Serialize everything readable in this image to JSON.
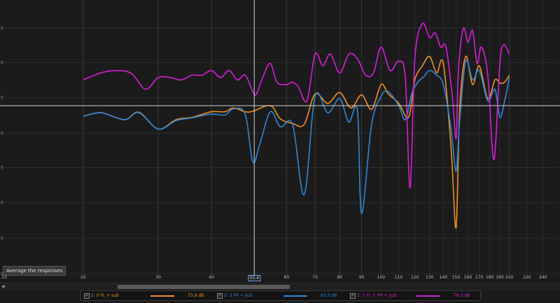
{
  "tooltip": "Average the responses",
  "cursor_x_label": "50,4",
  "colors": {
    "orange": "#f0901e",
    "blue": "#2f86d6",
    "magenta": "#d81ed8",
    "grid": "#2c2c2c",
    "crosshair": "#d0d0d0"
  },
  "legend": [
    {
      "name": "1: 0 FL + sub",
      "value": "73,9 dB",
      "color": "#f0901e"
    },
    {
      "name": "2: 2 FR + sub",
      "value": "63,3 dB",
      "color": "#2f86d6"
    },
    {
      "name": "3: 1 FL + FR + sub",
      "value": "78,3 dB",
      "color": "#d81ed8"
    }
  ],
  "x_tick_labels": [
    "13",
    "20",
    "30",
    "40",
    "50,4",
    "60",
    "70",
    "80",
    "90",
    "100",
    "110",
    "120",
    "130",
    "140",
    "150",
    "160",
    "170",
    "180",
    "190",
    "200",
    "220",
    "240"
  ],
  "chart_data": {
    "type": "line",
    "xscale": "log",
    "xlim": [
      13,
      260
    ],
    "crosshair_x": 50.4,
    "y_tick_labels": [
      "5",
      "0",
      "5",
      "0",
      "5",
      "0",
      "5",
      "0",
      "5"
    ],
    "series": [
      {
        "name": "1: 0 FL + sub",
        "x": [
          20,
          22,
          25,
          27,
          30,
          33,
          36,
          40,
          43,
          45,
          48,
          50,
          55,
          58,
          62,
          66,
          70,
          75,
          80,
          85,
          90,
          95,
          100,
          104,
          110,
          116,
          120,
          125,
          130,
          135,
          140,
          146,
          150,
          153,
          158,
          164,
          170,
          178,
          185,
          190,
          195,
          200
        ],
        "y": [
          -2.3,
          -1.5,
          -3.0,
          -1.4,
          -5.0,
          -3.0,
          -2.5,
          -1.3,
          -1.3,
          -0.5,
          -1.3,
          -1.2,
          0.0,
          -2.8,
          -3.8,
          -4.0,
          2.5,
          0.5,
          2.8,
          -0.5,
          2.3,
          -0.8,
          4.5,
          2.5,
          0.5,
          -2.5,
          5.5,
          8.5,
          10.5,
          7.0,
          9.0,
          -9.0,
          -26.0,
          -0.5,
          10.5,
          4.5,
          8.5,
          1.5,
          5.5,
          4.8,
          5.0,
          6.5
        ]
      },
      {
        "name": "2: 2 FR + sub",
        "x": [
          20,
          22,
          25,
          27,
          30,
          33,
          36,
          40,
          43,
          45,
          48,
          50,
          52,
          55,
          58,
          62,
          66,
          70,
          75,
          80,
          84,
          88,
          90,
          95,
          100,
          104,
          110,
          114,
          118,
          122,
          126,
          130,
          135,
          140,
          146,
          150,
          153,
          158,
          164,
          170,
          178,
          185,
          190,
          195,
          200
        ],
        "y": [
          -2.3,
          -1.5,
          -3.0,
          -1.5,
          -5.0,
          -3.2,
          -2.6,
          -1.8,
          -2.0,
          -0.7,
          -1.8,
          -12.0,
          -8.0,
          -1.3,
          -4.5,
          -4.0,
          -19.0,
          2.0,
          -1.5,
          1.5,
          -3.5,
          -1.0,
          -23.0,
          -4.0,
          2.0,
          3.0,
          0.0,
          -3.0,
          2.5,
          5.0,
          6.2,
          7.5,
          6.5,
          4.5,
          -5.0,
          -14.0,
          -3.0,
          9.5,
          5.5,
          7.5,
          1.0,
          3.5,
          -2.5,
          1.0,
          6.0
        ]
      },
      {
        "name": "3: 1 FL + FR + sub",
        "x": [
          20,
          22,
          24,
          26,
          28,
          30,
          32,
          34,
          36,
          38,
          40,
          42,
          44,
          46,
          48,
          50,
          51,
          53,
          55,
          57,
          60,
          62,
          64,
          67,
          70,
          73,
          76,
          80,
          84,
          88,
          92,
          96,
          100,
          105,
          110,
          114,
          117,
          120,
          125,
          130,
          134,
          138,
          142,
          147,
          150,
          152,
          156,
          160,
          164,
          168,
          172,
          178,
          184,
          190,
          194,
          200
        ],
        "y": [
          5.5,
          7.0,
          7.5,
          6.8,
          3.5,
          6.0,
          6.0,
          5.5,
          6.5,
          6.5,
          7.5,
          6.0,
          7.5,
          5.5,
          6.5,
          3.0,
          2.5,
          6.5,
          9.0,
          5.0,
          4.5,
          5.0,
          4.0,
          1.0,
          11.0,
          8.5,
          11.0,
          7.0,
          11.0,
          10.0,
          6.5,
          7.0,
          12.5,
          7.5,
          9.5,
          6.0,
          -17.5,
          10.0,
          17.5,
          14.5,
          15.5,
          12.5,
          12.5,
          2.0,
          -7.0,
          8.0,
          16.5,
          13.5,
          16.0,
          9.0,
          12.5,
          6.5,
          -11.5,
          9.0,
          13.0,
          11.0
        ]
      }
    ]
  }
}
